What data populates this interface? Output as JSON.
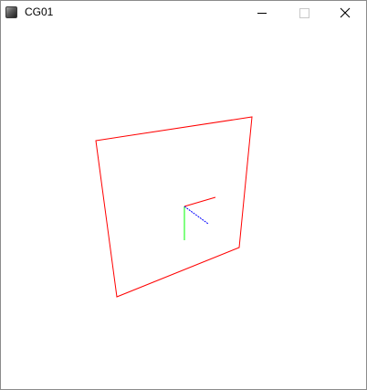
{
  "window": {
    "title": "CG01",
    "app_icon": "opengl-app-icon",
    "controls": {
      "minimize_icon": "minimize-icon",
      "maximize_icon": "maximize-icon",
      "close_icon": "close-icon"
    }
  },
  "scene": {
    "background": "#ffffff",
    "quad_color": "#ff0000",
    "axes": {
      "x_color": "#ff0000",
      "y_color": "#00ff00",
      "z_color": "#0000ff"
    }
  }
}
